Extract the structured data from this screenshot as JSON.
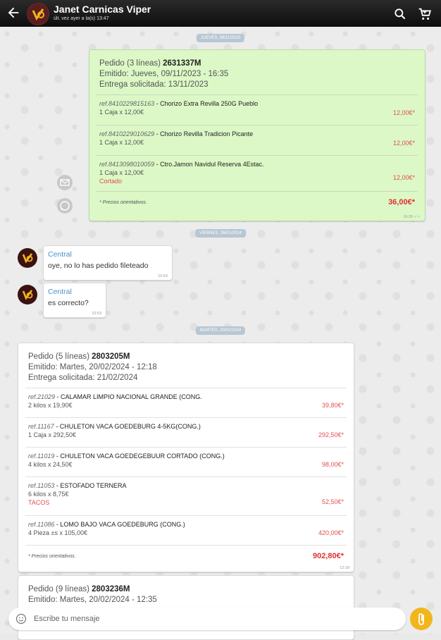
{
  "header": {
    "title": "Janet Carnicas Viper",
    "subtitle": "últ. vez ayer a la(s) 13:47"
  },
  "dates": [
    "JUEVES, 09/11/2023",
    "VIERNES, 26/01/2024",
    "MARTES, 20/02/2024"
  ],
  "order1": {
    "title_prefix": "Pedido (3 líneas) ",
    "number": "2631337M",
    "emitted": "Emitido: Jueves, 09/11/2023 - 16:35",
    "delivery": "Entrega solicitada: 13/11/2023",
    "lines": [
      {
        "ref": "ref.8410229815163",
        "name": " - Chorizo Extra Revilla 250G Pueblo",
        "qty": "1 Caja x 12,00€",
        "note": "",
        "price": "12,00€*"
      },
      {
        "ref": "ref.8410229010629",
        "name": " - Chorizo Revilla Tradicion Picante",
        "qty": "1 Caja x 12,00€",
        "note": "",
        "price": "12,00€*"
      },
      {
        "ref": "ref.8413098010059",
        "name": " - Ctro.Jamon Navidul Reserva 4Estac.",
        "qty": "1 Caja x 12,00€",
        "note": "Cortado",
        "price": "12,00€*"
      }
    ],
    "footnote": "* Precios orientativos.",
    "total": "36,00€*",
    "time": "16:35"
  },
  "messages": [
    {
      "sender": "Central",
      "text": "oye, no lo has pedido fileteado",
      "time": "10:53"
    },
    {
      "sender": "Central",
      "text": "es correcto?",
      "time": "10:53"
    }
  ],
  "order2": {
    "title_prefix": "Pedido (5 líneas) ",
    "number": "2803205M",
    "emitted": "Emitido: Martes, 20/02/2024 - 12:18",
    "delivery": "Entrega solicitada: 21/02/2024",
    "lines": [
      {
        "ref": "ref.21029",
        "name": " - CALAMAR LIMPIO NACIONAL GRANDE (CONG.",
        "qty": "2 kilos x 19,90€",
        "note": "",
        "price": "39,80€*"
      },
      {
        "ref": "ref.11167",
        "name": " - CHULETON VACA GOEDEBURG 4-5KG(CONG.)",
        "qty": "1 Caja x 292,50€",
        "note": "",
        "price": "292,50€*"
      },
      {
        "ref": "ref.11019",
        "name": " - CHULETON VACA GOEDEGEBUUR CORTADO (CONG.)",
        "qty": "4 kilos x 24,50€",
        "note": "",
        "price": "98,00€*"
      },
      {
        "ref": "ref.11053",
        "name": " - ESTOFADO TERNERA",
        "qty": "6 kilos x 8,75€",
        "note": "TACOS",
        "price": "52,50€*"
      },
      {
        "ref": "ref.11086",
        "name": " - LOMO BAJO VACA GOEDEBURG (CONG.)",
        "qty": "4 Pieza ±s x 105,00€",
        "note": "",
        "price": "420,00€*"
      }
    ],
    "footnote": "* Precios orientativos.",
    "total": "902,80€*",
    "time": "12:18"
  },
  "order3": {
    "title_prefix": "Pedido (9 líneas) ",
    "number": "2803236M",
    "emitted": "Emitido: Martes, 20/02/2024 - 12:35"
  },
  "input": {
    "placeholder": "Escribe tu mensaje"
  },
  "colors": {
    "accent": "#f2b51c",
    "sent_bubble": "#dcf8c6",
    "price_red": "#e05050",
    "sender_blue": "#4a8fc8"
  }
}
